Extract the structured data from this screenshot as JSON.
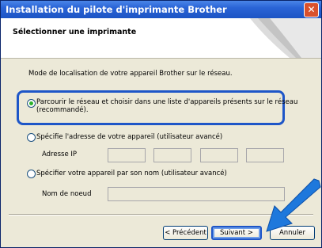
{
  "window": {
    "title": "Installation du pilote d'imprimante Brother",
    "header_title": "Sélectionner une imprimante"
  },
  "body": {
    "description": "Mode de localisation de votre appareil Brother sur le réseau.",
    "option1_line1": "Parcourir le réseau et choisir dans une liste d'appareils présents sur le réseau",
    "option1_line2": "(recommandé).",
    "option1_checked": true,
    "option2_label": "Spécifie l'adresse de votre appareil (utilisateur avancé)",
    "ip_label": "Adresse IP",
    "ip_fields": [
      "",
      "",
      "",
      ""
    ],
    "option3_label": "Spécifier votre appareil par son nom (utilisateur avancé)",
    "node_label": "Nom de noeud",
    "node_value": ""
  },
  "buttons": {
    "back_label": "< Précédent",
    "next_label": "Suivant >",
    "cancel_label": "Annuler"
  },
  "colors": {
    "highlight": "#1e56c8",
    "arrow": "#1e78dc",
    "titlebar": "#2a64d6"
  }
}
